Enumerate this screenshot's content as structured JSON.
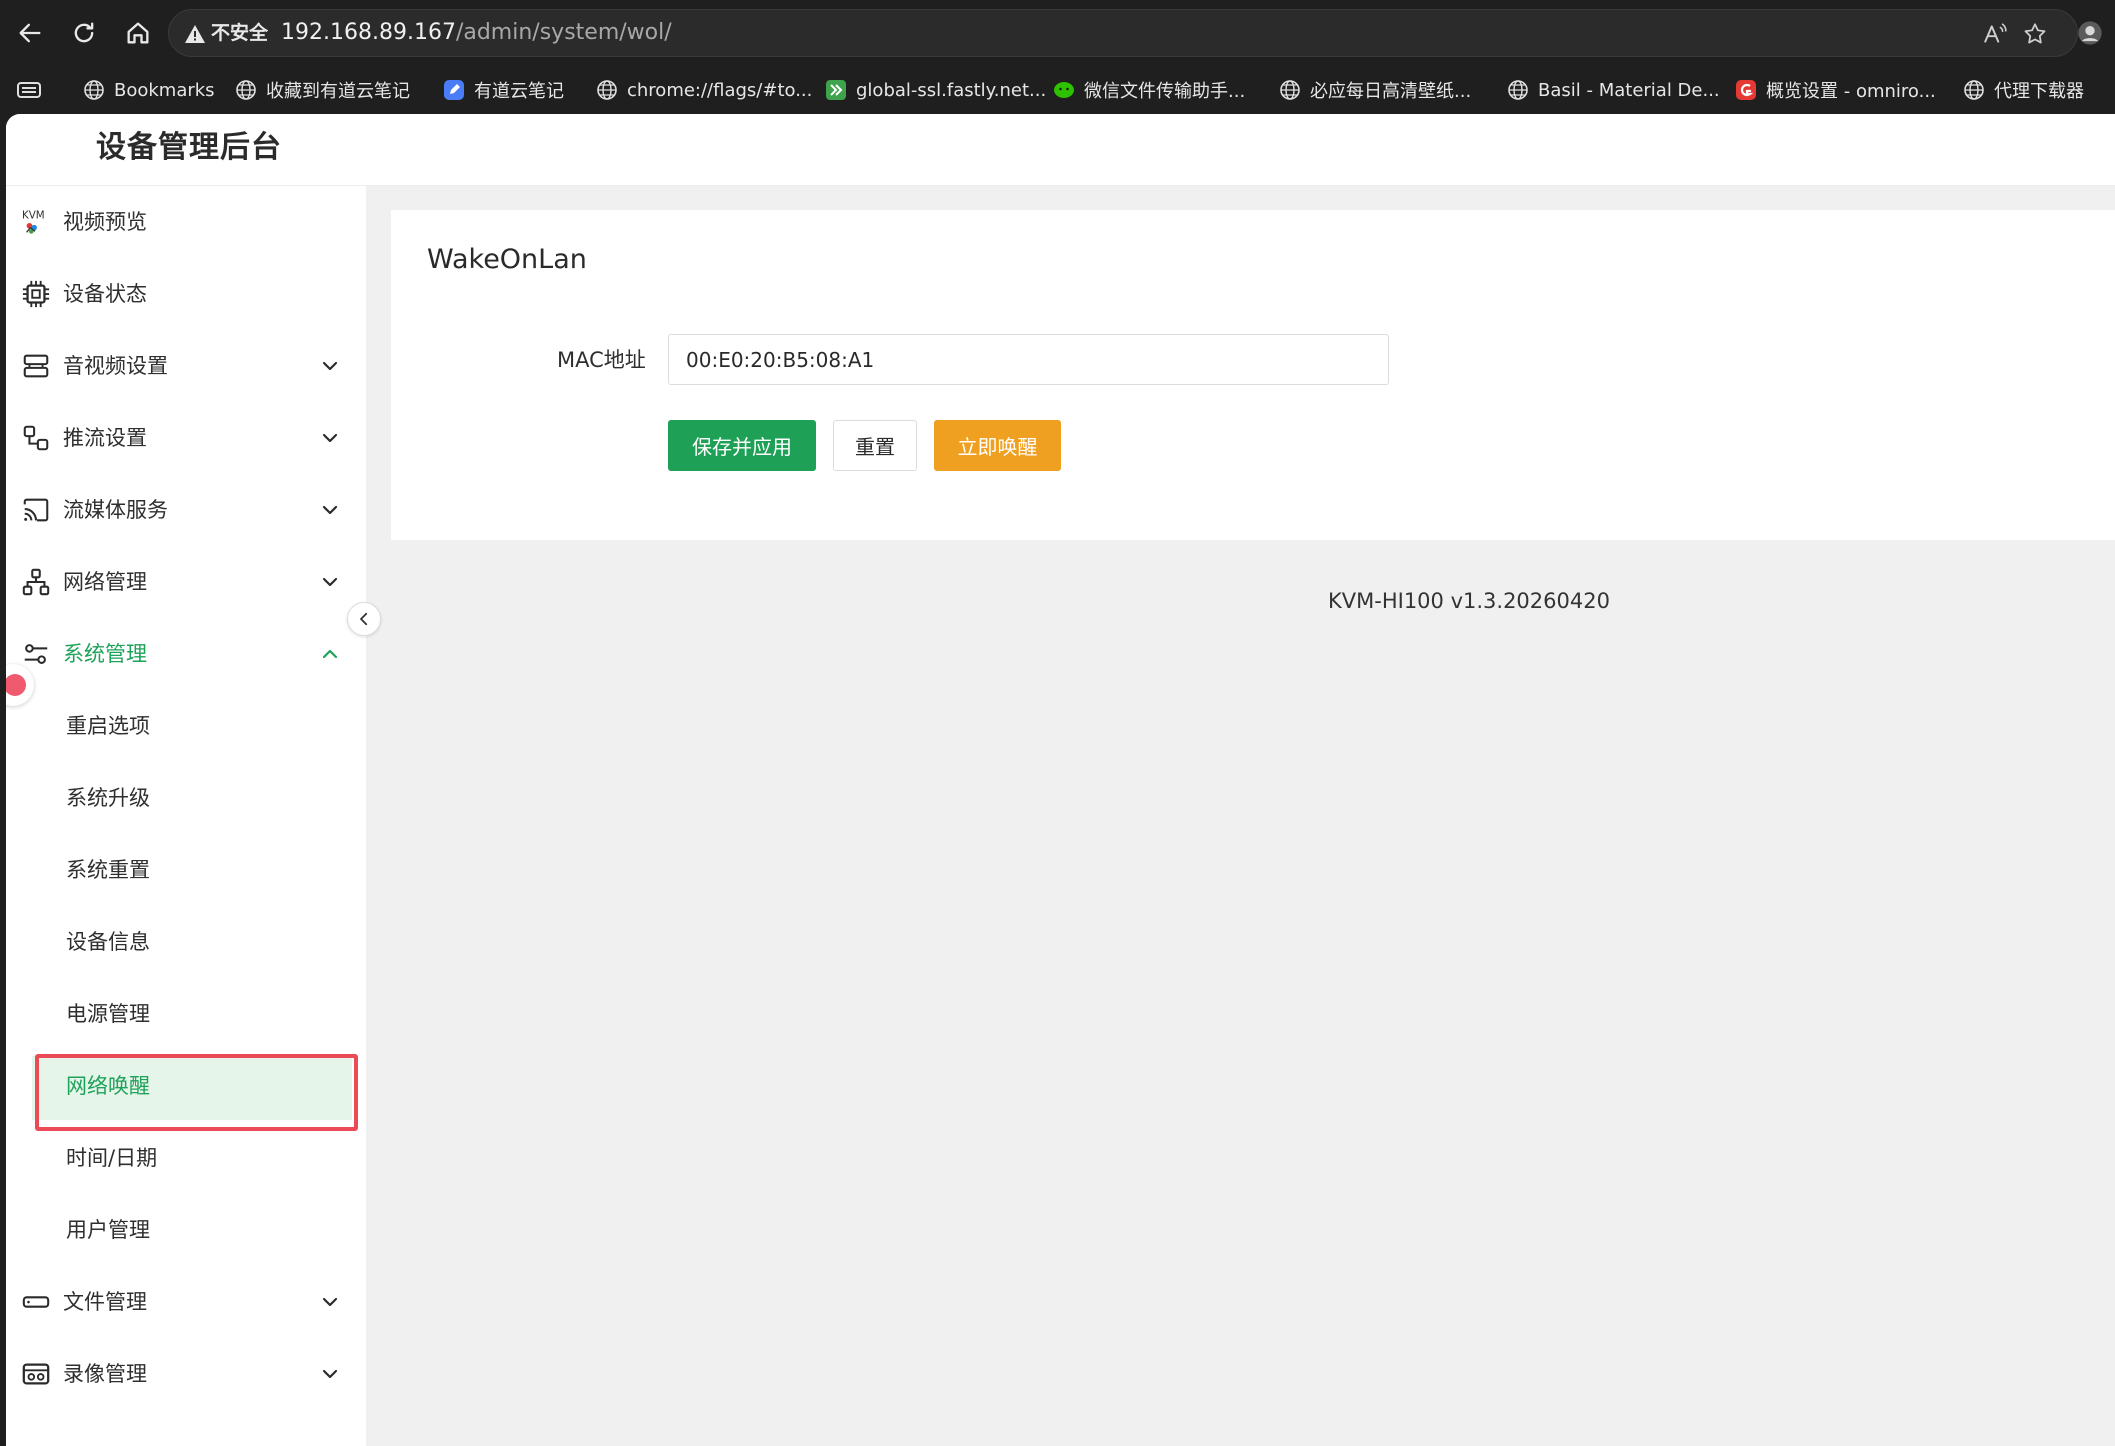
{
  "browser": {
    "security_label": "不安全",
    "url_host": "192.168.89.167",
    "url_path": "/admin/system/wol/",
    "bookmarks": [
      {
        "label": "Bookmarks",
        "icon": "globe-icon"
      },
      {
        "label": "收藏到有道云笔记",
        "icon": "globe-icon"
      },
      {
        "label": "有道云笔记",
        "icon": "youdao-note-icon"
      },
      {
        "label": "chrome://flags/#to...",
        "icon": "globe-icon"
      },
      {
        "label": "global-ssl.fastly.net...",
        "icon": "fastly-icon"
      },
      {
        "label": "微信文件传输助手...",
        "icon": "wechat-icon"
      },
      {
        "label": "必应每日高清壁纸...",
        "icon": "globe-icon"
      },
      {
        "label": "Basil - Material De...",
        "icon": "globe-icon"
      },
      {
        "label": "概览设置 - omniro...",
        "icon": "omnirom-icon"
      },
      {
        "label": "代理下载器",
        "icon": "globe-icon"
      }
    ]
  },
  "app": {
    "title": "设备管理后台"
  },
  "sidebar": {
    "items": [
      {
        "label": "视频预览",
        "icon": "kvm-logo-icon",
        "expandable": false
      },
      {
        "label": "设备状态",
        "icon": "chip-icon",
        "expandable": false
      },
      {
        "label": "音视频设置",
        "icon": "av-settings-icon",
        "expandable": true
      },
      {
        "label": "推流设置",
        "icon": "stream-icon",
        "expandable": true
      },
      {
        "label": "流媒体服务",
        "icon": "cast-icon",
        "expandable": true
      },
      {
        "label": "网络管理",
        "icon": "network-icon",
        "expandable": true
      },
      {
        "label": "系统管理",
        "icon": "sliders-icon",
        "expandable": true,
        "expanded": true
      },
      {
        "label": "文件管理",
        "icon": "storage-icon",
        "expandable": true
      },
      {
        "label": "录像管理",
        "icon": "recorder-icon",
        "expandable": true
      }
    ],
    "system_sub_items": [
      {
        "label": "重启选项"
      },
      {
        "label": "系统升级"
      },
      {
        "label": "系统重置"
      },
      {
        "label": "设备信息"
      },
      {
        "label": "电源管理"
      },
      {
        "label": "网络唤醒",
        "selected": true
      },
      {
        "label": "时间/日期"
      },
      {
        "label": "用户管理"
      }
    ]
  },
  "main": {
    "card_title": "WakeOnLan",
    "mac_label": "MAC地址",
    "mac_value": "00:E0:20:B5:08:A1",
    "buttons": {
      "save": "保存并应用",
      "reset": "重置",
      "wake": "立即唤醒"
    },
    "version": "KVM-HI100 v1.3.20260420"
  },
  "colors": {
    "accent_green": "#1ea057",
    "accent_orange": "#f0a021",
    "highlight_red": "#ea4b55",
    "selected_bg": "#e6f5ea"
  }
}
